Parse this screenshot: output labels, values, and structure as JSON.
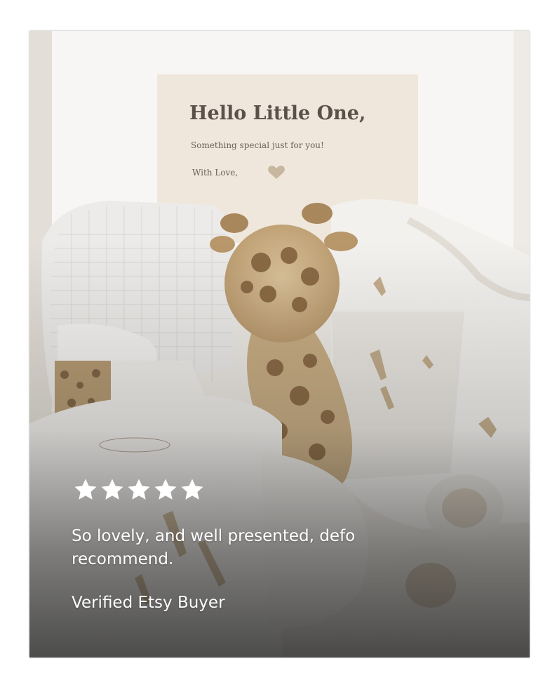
{
  "note": {
    "title": "Hello Little One,",
    "subtitle": "Something special just for you!",
    "sign": "With Love,"
  },
  "review": {
    "rating": 5,
    "rating_max": 5,
    "text": "So lovely, and well presented, defo recommend.",
    "reviewer": "Verified Etsy Buyer"
  },
  "colors": {
    "star": "#ffffff",
    "text": "#ffffff",
    "overlay": "#1e1e1e",
    "note_text": "#5a524a",
    "heart": "#c7b79e"
  }
}
